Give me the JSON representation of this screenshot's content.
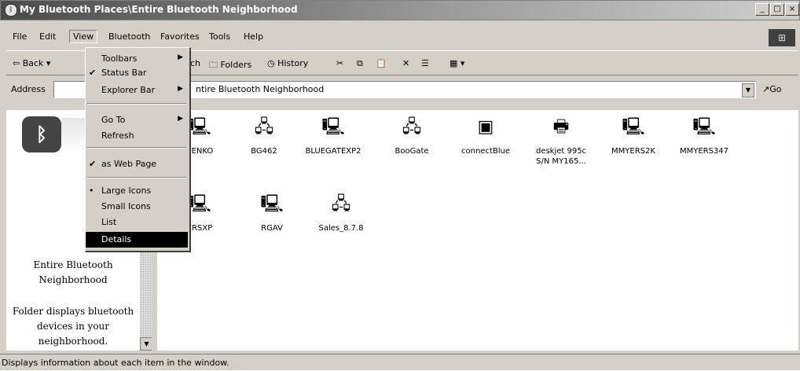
{
  "window": {
    "title": "My Bluetooth Places\\Entire Bluetooth Neighborhood",
    "controls": [
      "_",
      "□",
      "×"
    ]
  },
  "menubar": [
    "File",
    "Edit",
    "View",
    "Bluetooth",
    "Favorites",
    "Tools",
    "Help"
  ],
  "toolbar": {
    "back": "⇦ Back ▾",
    "search_frag": "ch",
    "folders": "Folders",
    "history": "History"
  },
  "address": {
    "label": "Address",
    "value": "ntire Bluetooth Neighborhood",
    "go": "Go"
  },
  "view_menu": {
    "items": [
      {
        "label": "Toolbars",
        "check": "",
        "submenu": true
      },
      {
        "label": "Status Bar",
        "check": "✔",
        "submenu": false
      },
      {
        "label": "Explorer Bar",
        "check": "",
        "submenu": true
      },
      {
        "label": "Go To",
        "check": "",
        "submenu": true
      },
      {
        "label": "Refresh",
        "check": "",
        "submenu": false
      },
      {
        "label": "as Web Page",
        "check": "✔",
        "submenu": false
      },
      {
        "label": "Large Icons",
        "check": "•",
        "submenu": false
      },
      {
        "label": "Small Icons",
        "check": "",
        "submenu": false
      },
      {
        "label": "List",
        "check": "",
        "submenu": false
      },
      {
        "label": "Details",
        "check": "",
        "submenu": false
      }
    ]
  },
  "left_pane": {
    "title": "Entire Bluetooth Neighborhood",
    "description": "Folder displays bluetooth devices in your neighborhood."
  },
  "devices": [
    {
      "label": "BENKO",
      "icon": "computer-icon"
    },
    {
      "label": "BG462",
      "icon": "network-icon"
    },
    {
      "label": "BLUEGATEXP2",
      "icon": "computer-icon"
    },
    {
      "label": "BooGate",
      "icon": "network-icon"
    },
    {
      "label": "connectBlue",
      "icon": "device-icon"
    },
    {
      "label": "deskjet 995c",
      "label2": "S/N MY165...",
      "icon": "printer-icon"
    },
    {
      "label": "MMYERS2K",
      "icon": "computer-icon"
    },
    {
      "label": "MMYERS347",
      "icon": "computer-icon"
    },
    {
      "label": "ERSXP",
      "icon": "computer-icon"
    },
    {
      "label": "RGAV",
      "icon": "computer-icon"
    },
    {
      "label": "Sales_8.7.8",
      "icon": "network-icon"
    }
  ],
  "status": "Displays information about each item in the window."
}
